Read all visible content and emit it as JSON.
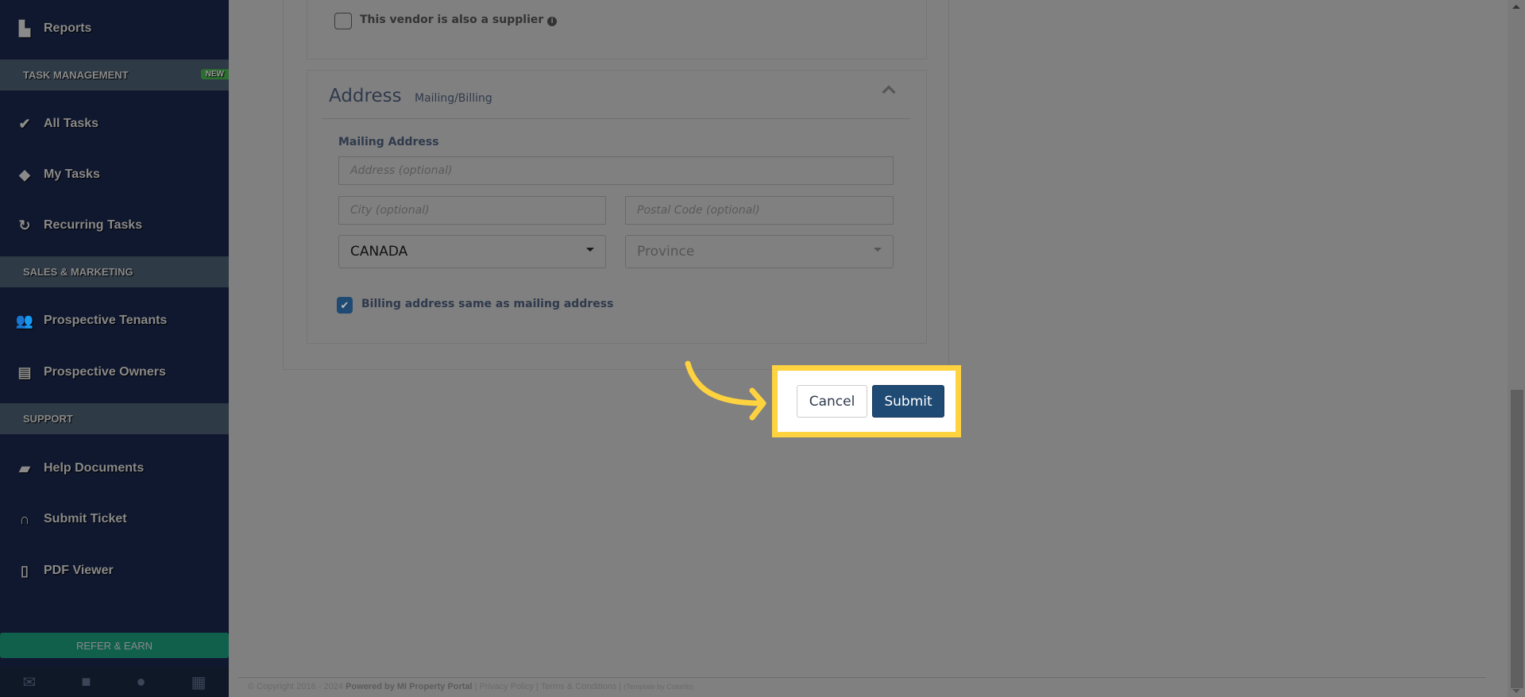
{
  "sidebar": {
    "items": [
      {
        "label": "Reports",
        "icon": "bar-chart-icon"
      },
      {
        "label": "All Tasks",
        "icon": "check-icon"
      },
      {
        "label": "My Tasks",
        "icon": "tag-icon"
      },
      {
        "label": "Recurring Tasks",
        "icon": "refresh-icon"
      },
      {
        "label": "Prospective Tenants",
        "icon": "users-icon"
      },
      {
        "label": "Prospective Owners",
        "icon": "id-card-icon"
      },
      {
        "label": "Help Documents",
        "icon": "book-icon"
      },
      {
        "label": "Submit Ticket",
        "icon": "headphones-icon"
      },
      {
        "label": "PDF Viewer",
        "icon": "pdf-file-icon"
      }
    ],
    "sections": {
      "task_management": "TASK MANAGEMENT",
      "new_badge": "NEW",
      "sales_marketing": "SALES & MARKETING",
      "support": "SUPPORT"
    },
    "refer": "REFER & EARN",
    "bottom_icons": [
      "envelope-icon",
      "briefcase-icon",
      "user-icon",
      "calculator-icon"
    ]
  },
  "form": {
    "supplier_checkbox": {
      "label": "This vendor is also a supplier",
      "checked": false
    },
    "address": {
      "title": "Address",
      "subtitle": "Mailing/Billing",
      "mailing_label": "Mailing Address",
      "address_placeholder": "Address (optional)",
      "city_placeholder": "City (optional)",
      "postal_placeholder": "Postal Code (optional)",
      "country": "CANADA",
      "province_placeholder": "Province",
      "billing_same": {
        "label": "Billing address same as mailing address",
        "checked": true
      }
    },
    "cancel": "Cancel",
    "submit": "Submit"
  },
  "footer": {
    "copyright": "© Copyright 2016 - 2024",
    "powered": "Powered by MI Property Portal",
    "privacy": "Privacy Policy",
    "terms": "Terms & Conditions",
    "template": "(Template by Colorlib)"
  },
  "colors": {
    "highlight": "#ffd23f",
    "submit": "#1f4a73",
    "sidebar": "#10182f"
  }
}
